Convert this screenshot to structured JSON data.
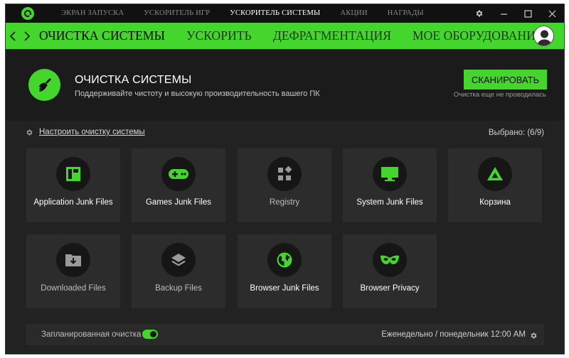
{
  "titlebar": {
    "tabs": [
      {
        "label": "ЭКРАН ЗАПУСКА"
      },
      {
        "label": "УСКОРИТЕЛЬ ИГР"
      },
      {
        "label": "УСКОРИТЕЛЬ СИСТЕМЫ"
      },
      {
        "label": "АКЦИИ"
      },
      {
        "label": "НАГРАДЫ"
      }
    ],
    "active_tab": "УСКОРИТЕЛЬ СИСТЕМЫ",
    "controls": {
      "settings": "⚙",
      "minimize": "–",
      "maximize": "☐",
      "close": "✕"
    }
  },
  "navbar": {
    "tabs": [
      {
        "label": "ОЧИСТКА СИСТЕМЫ"
      },
      {
        "label": "УСКОРИТЬ"
      },
      {
        "label": "ДЕФРАГМЕНТАЦИЯ"
      },
      {
        "label": "МОЕ ОБОРУДОВАНИЕ"
      }
    ],
    "active_tab": "ОЧИСТКА СИСТЕМЫ"
  },
  "header": {
    "title": "ОЧИСТКА СИСТЕМЫ",
    "subtitle": "Поддерживайте чистоту и высокую производительность вашего ПК",
    "scan_button": "СКАНИРОВАТЬ",
    "scan_status": "Очистка еще не проводилась"
  },
  "content": {
    "configure_link": "Настроить очистку системы",
    "selected": "Выбрано: (6/9)",
    "tiles": [
      {
        "label": "Application Junk Files",
        "icon": "app-panel-icon",
        "enabled": true
      },
      {
        "label": "Games Junk Files",
        "icon": "gamepad-icon",
        "enabled": true
      },
      {
        "label": "Registry",
        "icon": "registry-blocks-icon",
        "enabled": false
      },
      {
        "label": "System Junk Files",
        "icon": "monitor-icon",
        "enabled": true
      },
      {
        "label": "Корзина",
        "icon": "recycle-icon",
        "enabled": true
      },
      {
        "label": "Downloaded Files",
        "icon": "download-folder-icon",
        "enabled": false
      },
      {
        "label": "Backup Files",
        "icon": "layers-icon",
        "enabled": false
      },
      {
        "label": "Browser Junk Files",
        "icon": "globe-icon",
        "enabled": true
      },
      {
        "label": "Browser Privacy",
        "icon": "mask-icon",
        "enabled": true
      }
    ]
  },
  "schedule": {
    "label": "Запланированная очистка",
    "enabled": true,
    "value": "Еженедельно / понедельник 12:00 AM"
  },
  "colors": {
    "accent": "#44d62c",
    "background": "#1e1e1e",
    "tile": "#2c2c2c"
  }
}
